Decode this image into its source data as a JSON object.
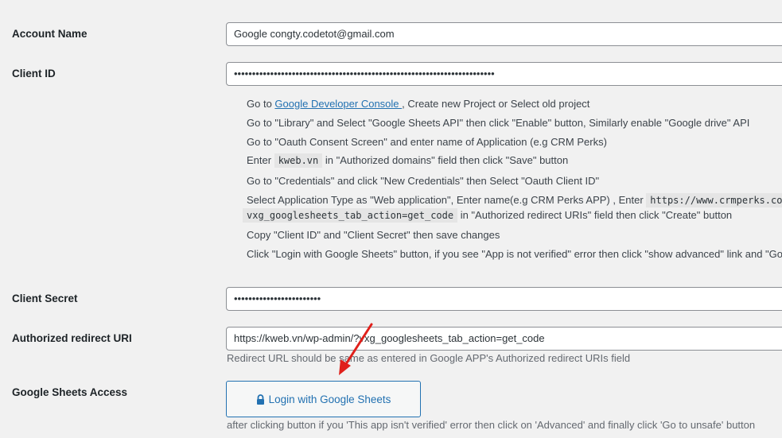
{
  "account_name": {
    "label": "Account Name",
    "value": "Google congty.codetot@gmail.com"
  },
  "client_id": {
    "label": "Client ID",
    "value": "••••••••••••••••••••••••••••••••••••••••••••••••••••••••••••••••••••••••"
  },
  "instructions": {
    "step1_prefix": "Go to ",
    "step1_link": "Google Developer Console ",
    "step1_suffix": ", Create new Project or Select old project",
    "step2": "Go to \"Library\" and Select \"Google Sheets API\" then click \"Enable\" button, Similarly enable \"Google drive\" API",
    "step3": "Go to \"Oauth Consent Screen\" and enter name of Application (e.g CRM Perks)",
    "step4_prefix": "Enter ",
    "step4_code": "kweb.vn",
    "step4_suffix": " in \"Authorized domains\" field then click \"Save\" button",
    "step5": "Go to \"Credentials\" and click \"New Credentials\" then Select \"Oauth Client ID\"",
    "step6_prefix": "Select Application Type as \"Web application\", Enter name(e.g CRM Perks APP) , Enter ",
    "step6_code1": "https://www.crmperks.com/",
    "step6_code2": "vxg_googlesheets_tab_action=get_code",
    "step6_suffix": " in \"Authorized redirect URIs\" field then click \"Create\" button",
    "step7": "Copy \"Client ID\" and \"Client Secret\" then save changes",
    "step8": "Click \"Login with Google Sheets\" button, if you see \"App is not verified\" error then click \"show advanced\" link and \"Go"
  },
  "client_secret": {
    "label": "Client Secret",
    "value": "••••••••••••••••••••••••"
  },
  "redirect_uri": {
    "label": "Authorized redirect URI",
    "value": "https://kweb.vn/wp-admin/?vxg_googlesheets_tab_action=get_code",
    "hint": "Redirect URL should be same as entered in Google APP's Authorized redirect URIs field"
  },
  "sheets_access": {
    "label": "Google Sheets Access",
    "button_label": "Login with Google Sheets",
    "button_icon": "lock-icon",
    "hint": "after clicking button if you 'This app isn't verified' error then click on 'Advanced' and finally click 'Go to unsafe' button"
  },
  "colors": {
    "link": "#2271b1",
    "annotation_arrow": "#e0201b",
    "background": "#f1f1f1"
  }
}
